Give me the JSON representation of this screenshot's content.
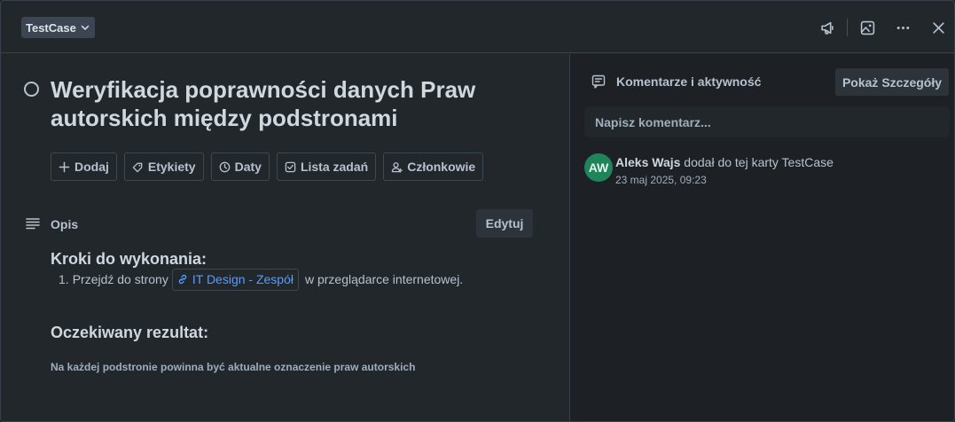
{
  "header": {
    "list_name": "TestCase",
    "icons": [
      "megaphone-icon",
      "image-icon",
      "more-icon",
      "close-icon"
    ]
  },
  "card": {
    "title": "Weryfikacja poprawności danych Praw autorskich między podstronami",
    "actions": [
      {
        "label": "Dodaj",
        "icon": "plus-icon"
      },
      {
        "label": "Etykiety",
        "icon": "tag-icon"
      },
      {
        "label": "Daty",
        "icon": "clock-icon"
      },
      {
        "label": "Lista zadań",
        "icon": "checkbox-icon"
      },
      {
        "label": "Członkowie",
        "icon": "user-icon"
      }
    ]
  },
  "description": {
    "label": "Opis",
    "edit_label": "Edytuj",
    "steps_heading": "Kroki do wykonania:",
    "steps": [
      {
        "number": "1.",
        "before": "Przejdź do strony",
        "link": "IT Design - Zespół",
        "after": "w przeglądarce internetowej."
      }
    ],
    "expected_heading": "Oczekiwany rezultat:",
    "expected_text": "Na każdej podstronie powinna być aktualne oznaczenie praw autorskich"
  },
  "sidebar": {
    "title": "Komentarze i aktywność",
    "show_details_label": "Pokaż Szczegóły",
    "comment_placeholder": "Napisz komentarz...",
    "activity": [
      {
        "initials": "AW",
        "name": "Aleks Wajs",
        "text": "dodał do tej karty TestCase",
        "time": "23 maj 2025, 09:23",
        "avatar_color": "#1f845a"
      }
    ]
  },
  "colors": {
    "background": "#22272b",
    "sidebar_background": "#1d2125",
    "link": "#579dff",
    "text": "#b6c2cf"
  }
}
